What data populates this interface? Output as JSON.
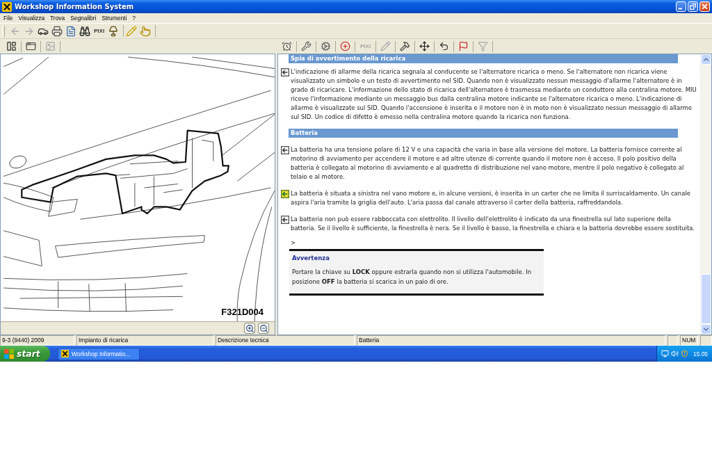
{
  "window": {
    "title": "Workshop Information System"
  },
  "menu": [
    "File",
    "Visualizza",
    "Trova",
    "Segnalibri",
    "Strumenti",
    "?"
  ],
  "toolbar": {
    "groups": [
      {
        "items": [
          {
            "kind": "icon",
            "disabled": true
          },
          {
            "kind": "icon",
            "disabled": true
          },
          {
            "kind": "icon",
            "disabled": false
          },
          {
            "kind": "icon",
            "disabled": false
          },
          {
            "kind": "icon",
            "disabled": false
          },
          {
            "kind": "icon",
            "disabled": false
          },
          {
            "kind": "text",
            "label": "PIXI",
            "disabled": false
          },
          {
            "kind": "icon",
            "disabled": false
          }
        ]
      },
      {
        "items": [
          {
            "kind": "icon",
            "disabled": false
          },
          {
            "kind": "icon",
            "disabled": false
          }
        ]
      }
    ]
  },
  "image_pane": {
    "toolbar": [
      {
        "kind": "icon",
        "disabled": false
      },
      {
        "kind": "icon",
        "disabled": false
      },
      {
        "kind": "icon",
        "disabled": true
      }
    ],
    "caption": "F321D004"
  },
  "text_pane": {
    "toolbar": [
      {
        "kind": "icon",
        "disabled": false
      },
      {
        "kind": "icon",
        "disabled": false
      },
      {
        "kind": "icon",
        "disabled": false
      },
      {
        "kind": "icon",
        "disabled": false
      },
      {
        "kind": "text",
        "label": "PIXI",
        "disabled": true
      },
      {
        "kind": "icon",
        "disabled": true
      },
      {
        "kind": "icon",
        "disabled": false
      },
      {
        "kind": "icon",
        "disabled": false
      },
      {
        "kind": "icon",
        "disabled": false
      },
      {
        "kind": "icon",
        "disabled": false
      },
      {
        "kind": "icon",
        "disabled": true
      }
    ],
    "sections": [
      {
        "heading": "Spia di avvertimento della ricarica",
        "paragraphs": [
          {
            "text": "L'indicazione di allarme della ricarica segnala al conducente se l'alternatore ricarica o meno. Se l'alternatore non ricarica viene visualizzato un simbolo e un testo di avvertimento nel SID. Quando non è visualizzato nessun messaggio d'allarme l'alternatore è in grado di ricaricare. L'informazione dello stato di ricarica dell'alternatore è trasmessa mediante un conduttore alla centralina motore. MIU riceve l'informazione mediante un messaggio bus dalla centralina motore indicante se l'alternatore ricarica o meno. L'indicazione di allarme è visualizzate sul SID. Quando l'accensione è inserita e il motore non è in moto non è visualizzato nessun messaggio di allarme sul SID. Un codice di difetto è emesso nella centralina motore quando la ricarica non funziona.",
            "highlighted": false
          }
        ]
      },
      {
        "heading": "Batteria",
        "paragraphs": [
          {
            "text": "La batteria ha una tensione polare di 12 V e una capacità che varia in base alla versione del motore. La batteria fornisce corrente al motorino di avviamento per accendere il motore e ad altre utenze di corrente quando il motore non è acceso. Il polo positivo della batteria è collegato al motorino di avviamento e al quadretto di distribuzione nel vano motore, mentre il polo negativo è collegato al telaio e al motore.",
            "highlighted": false
          },
          {
            "text": "La batteria è situata a sinistra nel vano motore e, in alcune versioni, è inserita in un carter che ne limita il surriscaldamento. Un canale aspira l'aria tramite la griglia dell'auto. L'aria passa dal canale attraverso il carter della batteria, raffreddandola.",
            "highlighted": true
          },
          {
            "text": "La batteria non può essere rabboccata con elettrolito. Il livello dell'elettrolito è indicato da una finestrella sul lato superiore della batteria. Se il livello è sufficiente, la finestrella è nera. Se il livello è basso, la finestrella e chiara e la batteria dovrebbe essere sostituita.",
            "highlighted": false
          }
        ]
      }
    ],
    "marker": ">",
    "warning": {
      "title": "Avvertenza",
      "text": "Portare la chiave su **LOCK** oppure estrarla quando non si utilizza l'automobile. In posizione **OFF** la batteria si scarica in un paio di ore."
    }
  },
  "status_bar": {
    "panels": [
      "9-3 (9440) 2009",
      "Impianto di ricarica",
      "Descrizione tecnica",
      "Batteria"
    ],
    "indicators": [
      "NUM"
    ]
  },
  "taskbar": {
    "start": "start",
    "tasks": [
      {
        "label": "Workshop Informatio...",
        "selected": false
      }
    ],
    "clock": "15.05"
  }
}
